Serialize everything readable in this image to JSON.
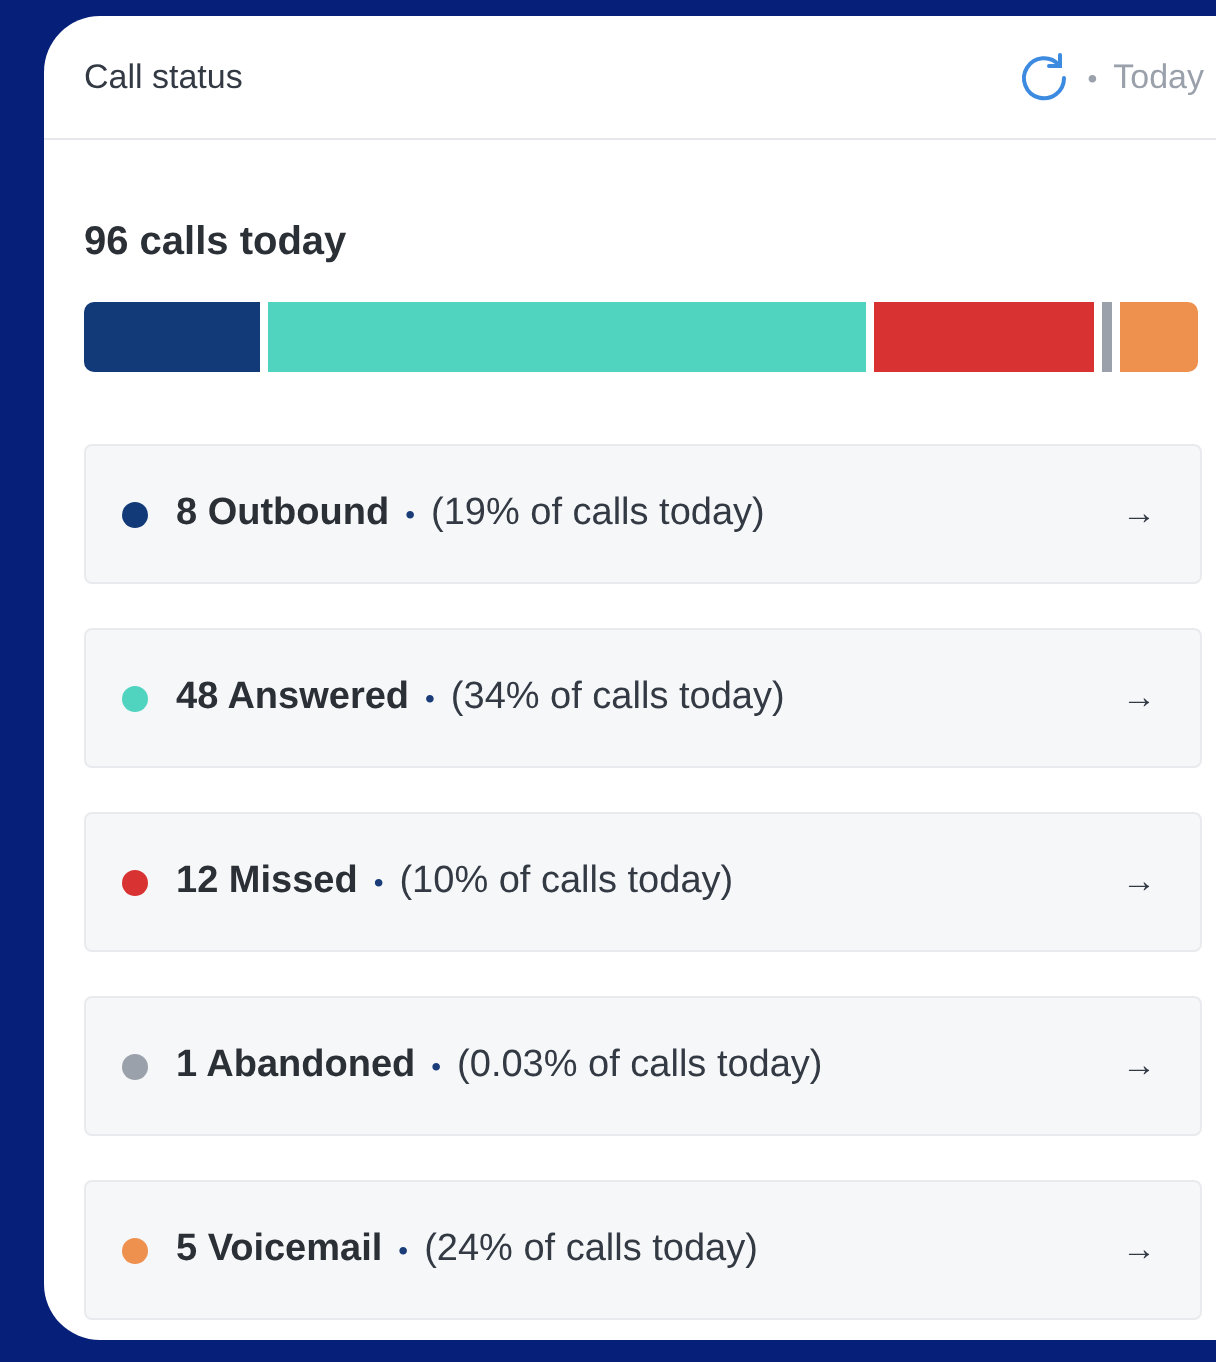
{
  "header": {
    "title": "Call status",
    "separator": "•",
    "period": "Today"
  },
  "summary": "96 calls today",
  "items": [
    {
      "label": "8 Outbound",
      "separator": "•",
      "share": "(19% of calls today)",
      "arrow": "→",
      "color": "#123a78"
    },
    {
      "label": "48 Answered",
      "separator": "•",
      "share": "(34% of calls today)",
      "arrow": "→",
      "color": "#50d4c0"
    },
    {
      "label": "12 Missed",
      "separator": "•",
      "share": "(10% of calls today)",
      "arrow": "→",
      "color": "#d93232"
    },
    {
      "label": "1 Abandoned",
      "separator": "•",
      "share": "(0.03% of calls today)",
      "arrow": "→",
      "color": "#9aa1ab"
    },
    {
      "label": "5 Voicemail",
      "separator": "•",
      "share": "(24% of calls today)",
      "arrow": "→",
      "color": "#ef914e"
    }
  ]
}
